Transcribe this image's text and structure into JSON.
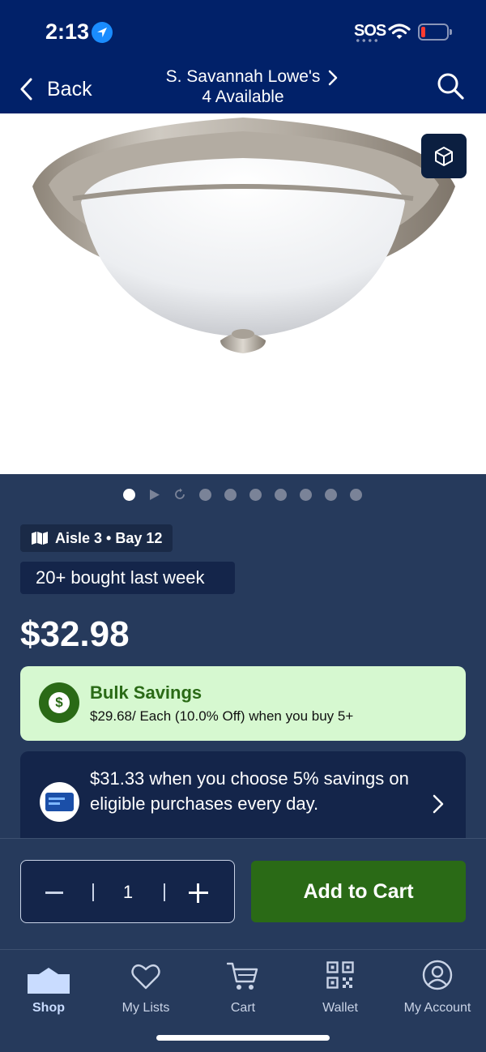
{
  "status_bar": {
    "time": "2:13",
    "sos": "SOS"
  },
  "nav": {
    "back_label": "Back",
    "store_name": "S. Savannah Lowe's",
    "availability": "4 Available"
  },
  "carousel": {
    "total_dots": 8,
    "active_index": 0
  },
  "location": {
    "aisle_text": "Aisle 3 • Bay 12"
  },
  "social_proof": "20+ bought last week",
  "price": "$32.98",
  "bulk_savings": {
    "title": "Bulk Savings",
    "detail": "$29.68/ Each (10.0% Off) when you buy 5+",
    "icon_symbol": "$"
  },
  "card_offer": {
    "text": "$31.33 when you choose 5% savings on eligible purchases every day."
  },
  "quantity": {
    "value": "1"
  },
  "cart_button": "Add to Cart",
  "tabs": [
    {
      "label": "Shop",
      "icon": "home-icon"
    },
    {
      "label": "My Lists",
      "icon": "heart-icon"
    },
    {
      "label": "Cart",
      "icon": "cart-icon"
    },
    {
      "label": "Wallet",
      "icon": "qr-code-icon"
    },
    {
      "label": "My Account",
      "icon": "account-icon"
    }
  ],
  "colors": {
    "nav_blue": "#012169",
    "panel": "#263a5c",
    "green": "#2a6a16",
    "bulk_bg": "#d6f8d0"
  }
}
